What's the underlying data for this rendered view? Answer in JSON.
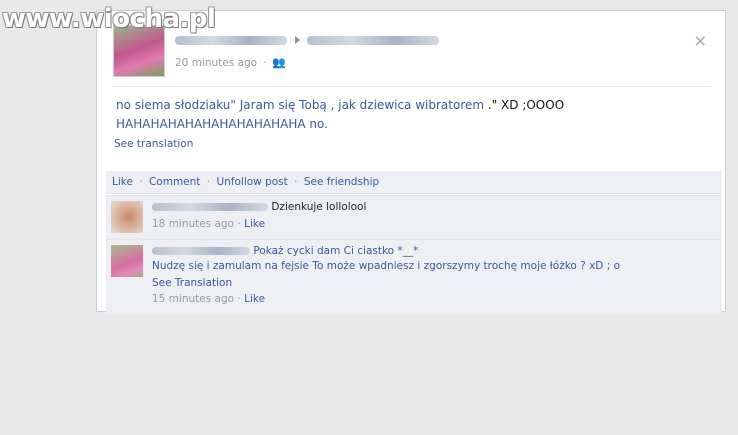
{
  "watermark": {
    "left": "www.",
    "brand": "wiocha",
    "tld": ".pl"
  },
  "post": {
    "timestamp": "20 minutes ago",
    "audience_icon": "friends-icon",
    "close_glyph": "×",
    "body_part1": "no siema słodziaku\" Jaram się Tobą , jak dziewica wibratorem",
    "body_part2": " .\" XD ;OOOO",
    "body_line2": "HAHAHAHAHAHAHAHAHAHAHA no.",
    "see_translation": "See translation",
    "actions": {
      "like": "Like",
      "comment": "Comment",
      "unfollow": "Unfollow post",
      "friendship": "See friendship",
      "separator": "·"
    }
  },
  "comments": [
    {
      "text": "Dzienkuje lollolool",
      "timestamp": "18 minutes ago",
      "like": "Like",
      "separator": "·"
    },
    {
      "text_line1": "Pokaż cycki dam Ci ciastko *__*",
      "text_line2": "Nudzę się i zamulam na fejsie To może wpadniesz i zgorszymy trochę moje łóżko ? xD ; o",
      "see_translation": "See Translation",
      "timestamp": "15 minutes ago",
      "like": "Like",
      "separator": "·"
    }
  ],
  "colors": {
    "link": "#3b5998",
    "muted": "#999999",
    "bar": "#edeff4"
  }
}
